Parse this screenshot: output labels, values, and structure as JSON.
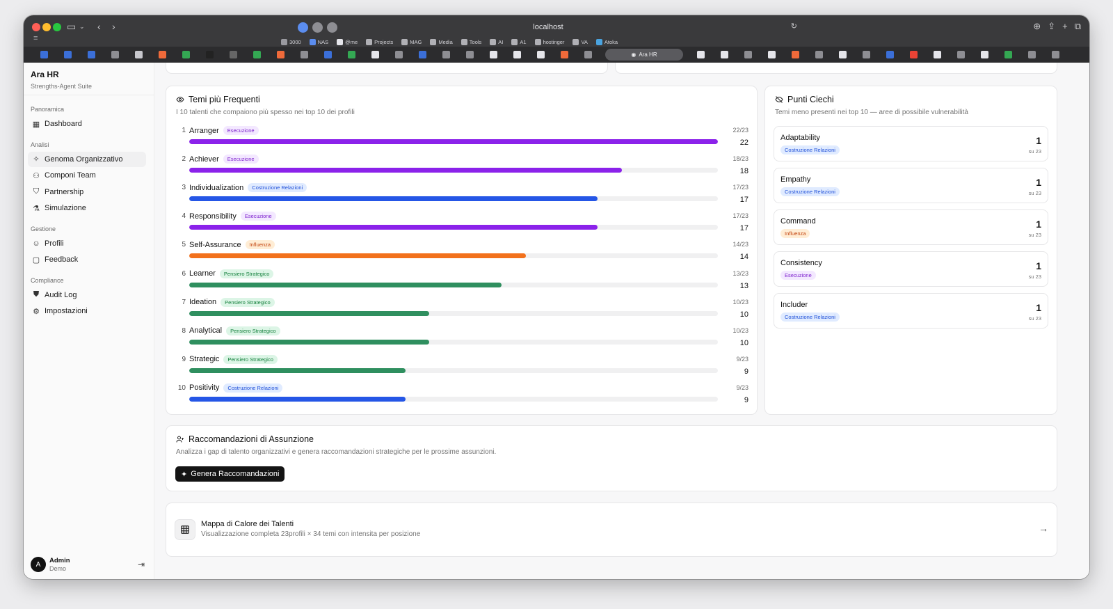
{
  "browser": {
    "address": "localhost",
    "active_tab": "Ara HR",
    "bookmarks": [
      "3000",
      "NAS",
      "@me",
      "Projects",
      "MAG",
      "Media",
      "Tools",
      "AI",
      "A1",
      "hostinger",
      "VA",
      "Atoka"
    ]
  },
  "sidebar": {
    "app_name": "Ara HR",
    "app_subtitle": "Strengths-Agent Suite",
    "groups": [
      {
        "label": "Panoramica",
        "items": [
          {
            "label": "Dashboard",
            "icon": "grid-icon"
          }
        ]
      },
      {
        "label": "Analisi",
        "items": [
          {
            "label": "Genoma Organizzativo",
            "icon": "sparkle-icon",
            "active": true
          },
          {
            "label": "Componi Team",
            "icon": "users-icon"
          },
          {
            "label": "Partnership",
            "icon": "handshake-icon"
          },
          {
            "label": "Simulazione",
            "icon": "flask-icon"
          }
        ]
      },
      {
        "label": "Gestione",
        "items": [
          {
            "label": "Profili",
            "icon": "user-circle-icon"
          },
          {
            "label": "Feedback",
            "icon": "message-icon"
          }
        ]
      },
      {
        "label": "Compliance",
        "items": [
          {
            "label": "Audit Log",
            "icon": "shield-icon"
          },
          {
            "label": "Impostazioni",
            "icon": "gear-icon"
          }
        ]
      }
    ],
    "user": {
      "initial": "A",
      "name": "Admin",
      "role": "Demo"
    }
  },
  "frequent": {
    "title": "Temi più Frequenti",
    "subtitle": "I 10 talenti che compaiono più spesso nei top 10 dei profili",
    "total": 23,
    "rows": [
      {
        "rank": "1",
        "name": "Arranger",
        "domain": "Esecuzione",
        "kind": "exec",
        "count": 22,
        "frac": "22/23",
        "color": "#8b22ea"
      },
      {
        "rank": "2",
        "name": "Achiever",
        "domain": "Esecuzione",
        "kind": "exec",
        "count": 18,
        "frac": "18/23",
        "color": "#8b22ea"
      },
      {
        "rank": "3",
        "name": "Individualization",
        "domain": "Costruzione Relazioni",
        "kind": "rel",
        "count": 17,
        "frac": "17/23",
        "color": "#2556e6"
      },
      {
        "rank": "4",
        "name": "Responsibility",
        "domain": "Esecuzione",
        "kind": "exec",
        "count": 17,
        "frac": "17/23",
        "color": "#8b22ea"
      },
      {
        "rank": "5",
        "name": "Self-Assurance",
        "domain": "Influenza",
        "kind": "inf",
        "count": 14,
        "frac": "14/23",
        "color": "#f2711c"
      },
      {
        "rank": "6",
        "name": "Learner",
        "domain": "Pensiero Strategico",
        "kind": "str",
        "count": 13,
        "frac": "13/23",
        "color": "#2f8f5f"
      },
      {
        "rank": "7",
        "name": "Ideation",
        "domain": "Pensiero Strategico",
        "kind": "str",
        "count": 10,
        "frac": "10/23",
        "color": "#2f8f5f"
      },
      {
        "rank": "8",
        "name": "Analytical",
        "domain": "Pensiero Strategico",
        "kind": "str",
        "count": 10,
        "frac": "10/23",
        "color": "#2f8f5f"
      },
      {
        "rank": "9",
        "name": "Strategic",
        "domain": "Pensiero Strategico",
        "kind": "str",
        "count": 9,
        "frac": "9/23",
        "color": "#2f8f5f"
      },
      {
        "rank": "10",
        "name": "Positivity",
        "domain": "Costruzione Relazioni",
        "kind": "rel",
        "count": 9,
        "frac": "9/23",
        "color": "#2556e6"
      }
    ]
  },
  "blind": {
    "title": "Punti Ciechi",
    "subtitle": "Temi meno presenti nei top 10 — aree di possibile vulnerabilità",
    "items": [
      {
        "name": "Adaptability",
        "domain": "Costruzione Relazioni",
        "kind": "rel",
        "value": "1",
        "of": "su 23"
      },
      {
        "name": "Empathy",
        "domain": "Costruzione Relazioni",
        "kind": "rel",
        "value": "1",
        "of": "su 23"
      },
      {
        "name": "Command",
        "domain": "Influenza",
        "kind": "inf",
        "value": "1",
        "of": "su 23"
      },
      {
        "name": "Consistency",
        "domain": "Esecuzione",
        "kind": "exec",
        "value": "1",
        "of": "su 23"
      },
      {
        "name": "Includer",
        "domain": "Costruzione Relazioni",
        "kind": "rel",
        "value": "1",
        "of": "su 23"
      }
    ]
  },
  "hiring": {
    "title": "Raccomandazioni di Assunzione",
    "subtitle": "Analizza i gap di talento organizzativi e genera raccomandazioni strategiche per le prossime assunzioni.",
    "button": "Genera Raccomandazioni"
  },
  "heatmap": {
    "title": "Mappa di Calore dei Talenti",
    "subtitle": "Visualizzazione completa 23profili × 34 temi con intensita per posizione"
  }
}
